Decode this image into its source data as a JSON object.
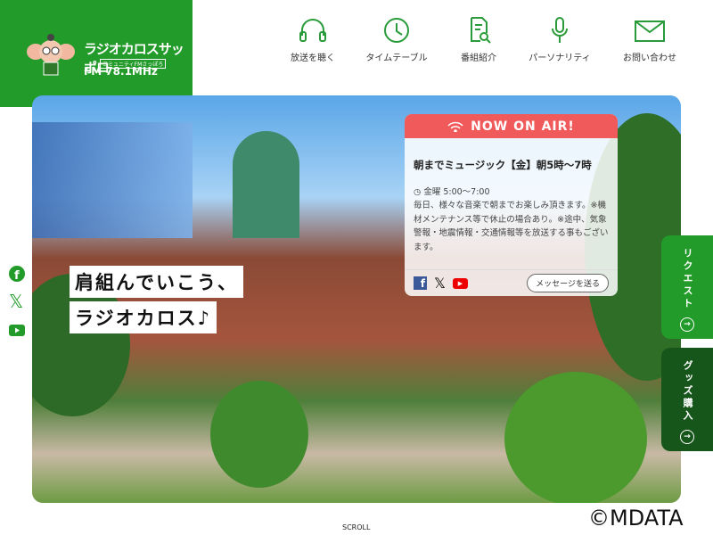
{
  "logo": {
    "name": "ラジオカロスサッポロ",
    "sub": "コミュニティFMさっぽろ",
    "freq": "FM 78.1MHz"
  },
  "nav": [
    {
      "label": "放送を聴く",
      "icon": "headphones-icon"
    },
    {
      "label": "タイムテーブル",
      "icon": "clock-icon"
    },
    {
      "label": "番組紹介",
      "icon": "document-search-icon"
    },
    {
      "label": "パーソナリティ",
      "icon": "microphone-icon"
    },
    {
      "label": "お問い合わせ",
      "icon": "mail-icon"
    }
  ],
  "hero": {
    "catch1": "肩組んでいこう、",
    "catch2": "ラジオカロス♪"
  },
  "onair": {
    "header": "NOW ON AIR!",
    "title": "朝までミュージック【金】朝5時～7時",
    "time": "金曜 5:00～7:00",
    "desc": "毎日、様々な音楽で朝までお楽しみ頂きます。※機材メンテナンス等で休止の場合あり。※途中、気象警報・地震情報・交通情報等を放送する事もございます。",
    "message_button": "メッセージを送る"
  },
  "side": {
    "request": "リクエスト",
    "goods": "グッズ購入",
    "arrow": "→"
  },
  "scroll": "SCROLL",
  "copyright": "©MDATA",
  "colors": {
    "brand": "#239b2a",
    "onair": "#f05a5a",
    "goods": "#17561b"
  }
}
